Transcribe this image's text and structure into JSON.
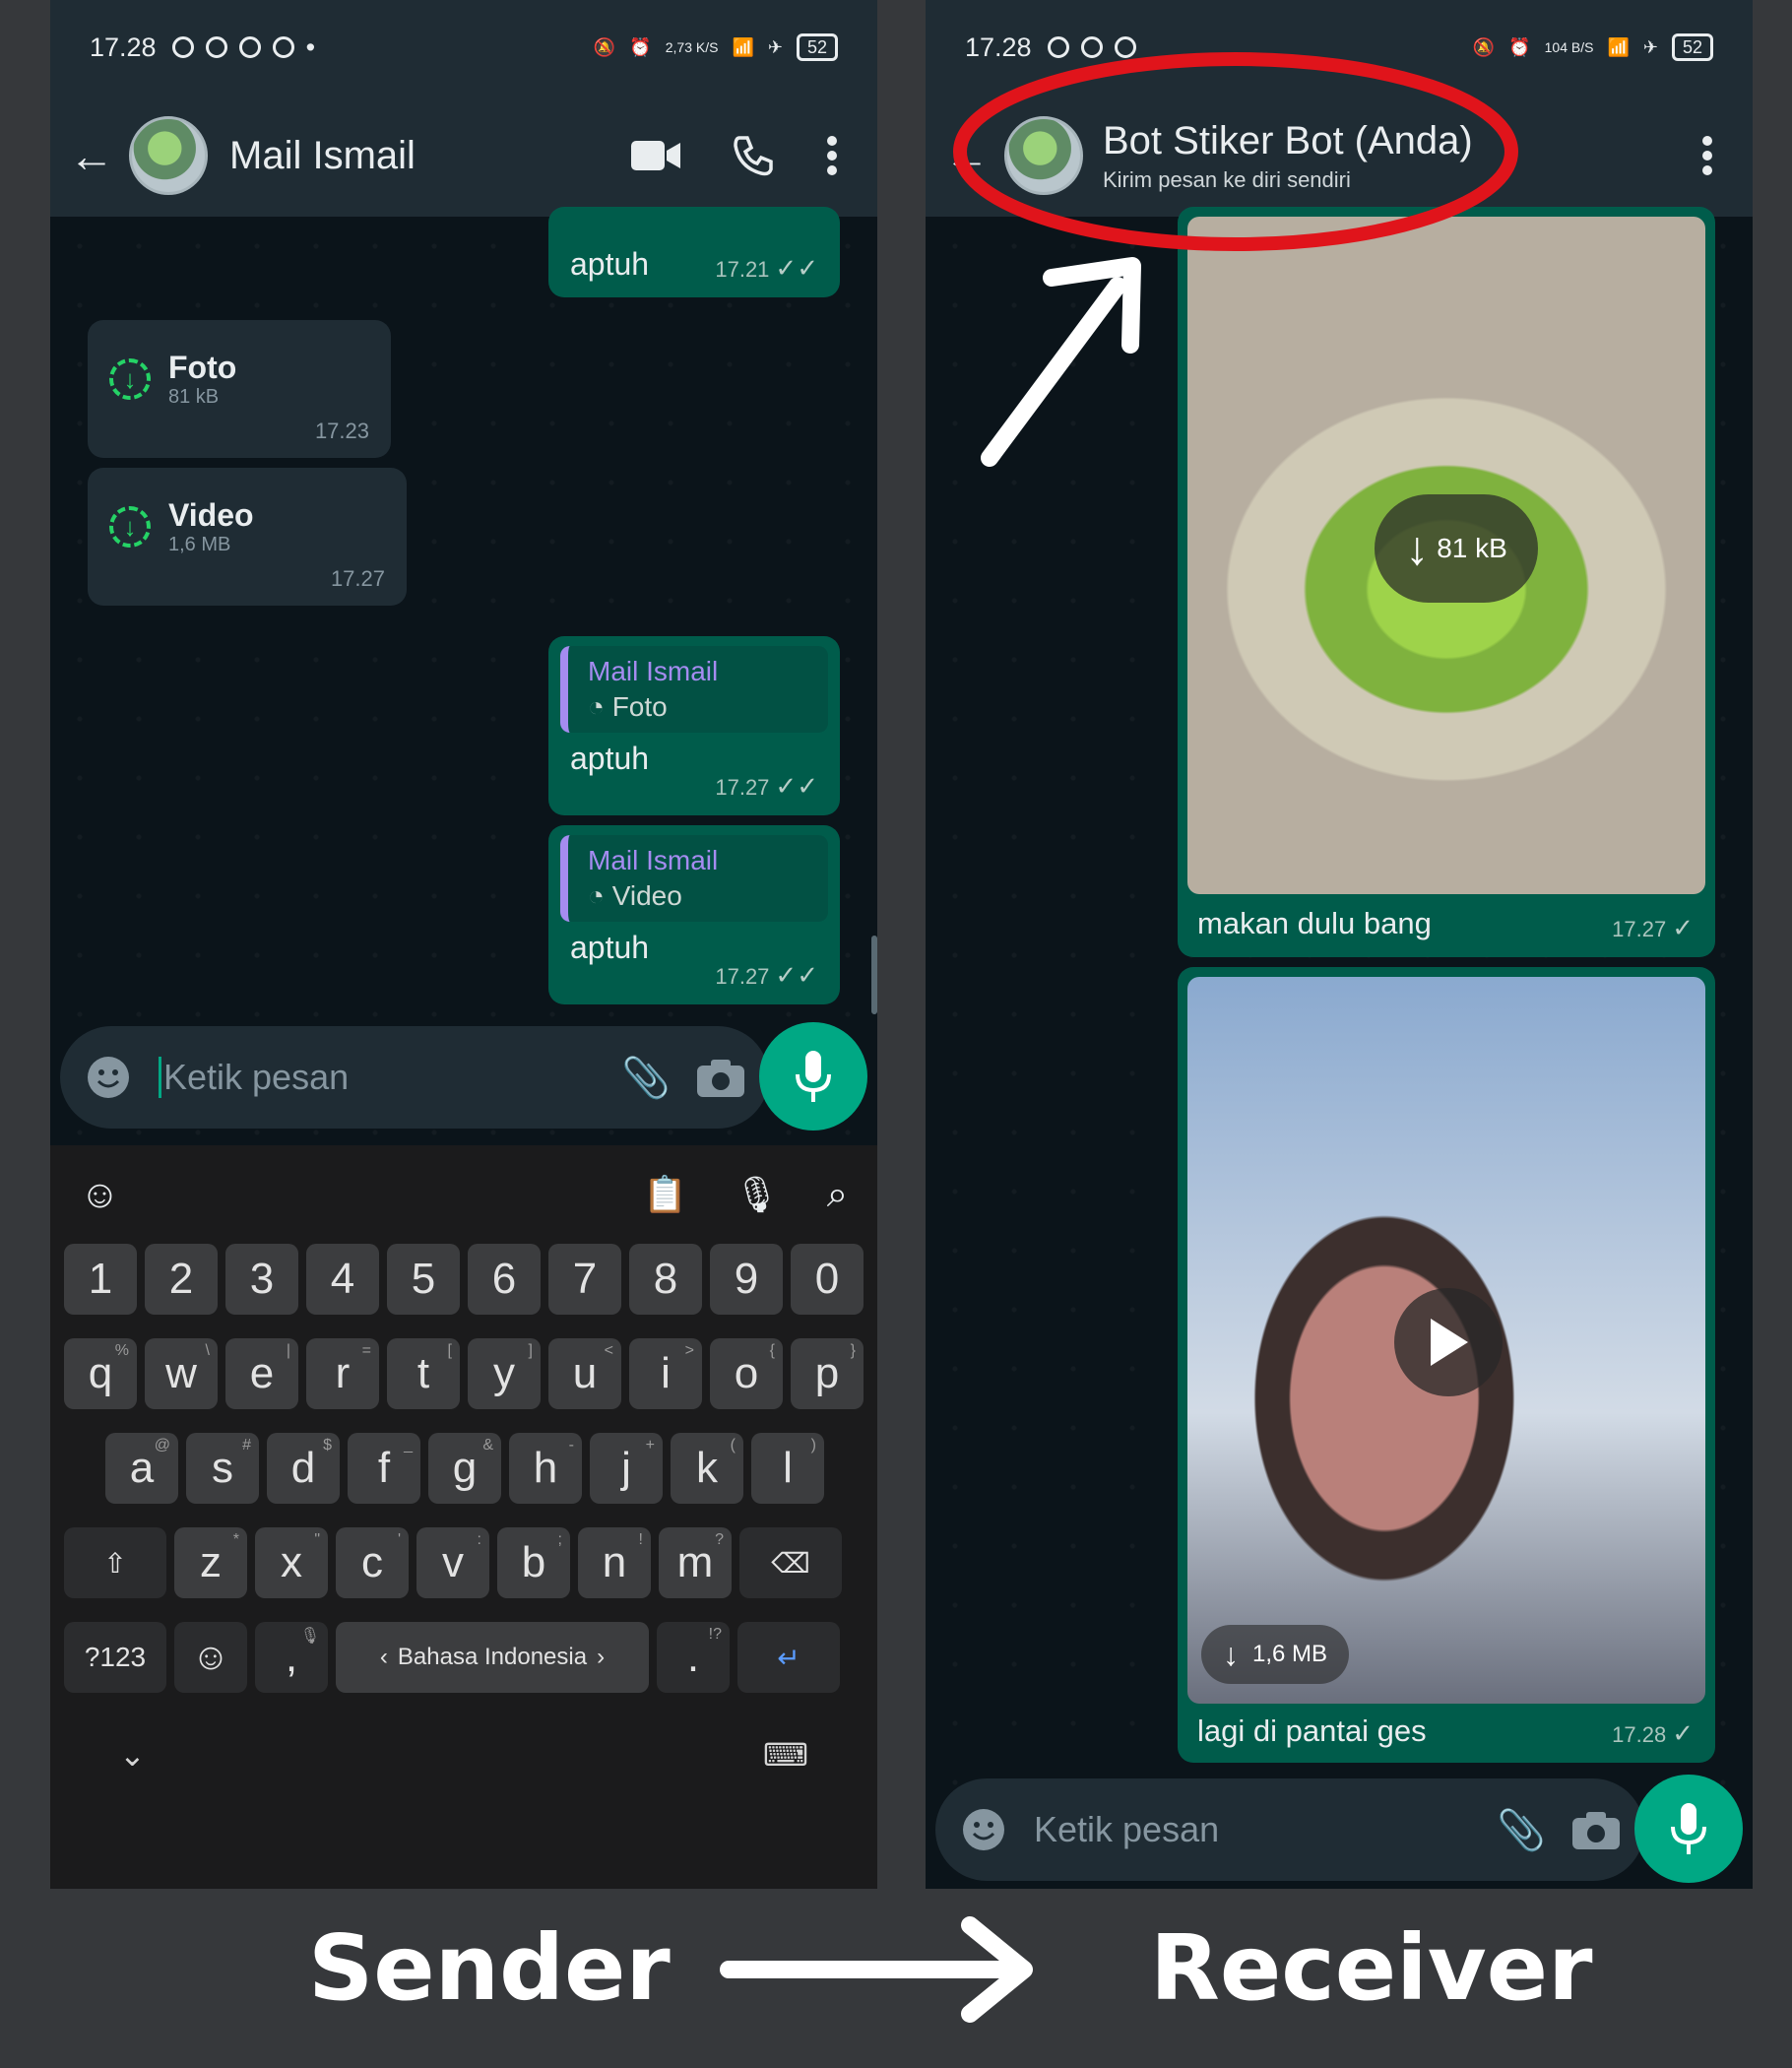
{
  "sender": {
    "status_time": "17.28",
    "net_speed": "2,73 K/S",
    "battery": "52",
    "contact_name": "Mail Ismail",
    "messages": [
      {
        "text": "aptuh",
        "time": "17.21"
      },
      {
        "file": "Foto",
        "size": "81 kB",
        "time": "17.23"
      },
      {
        "file": "Video",
        "size": "1,6 MB",
        "time": "17.27"
      },
      {
        "quote_name": "Mail Ismail",
        "quote_type": "Foto",
        "text": "aptuh",
        "time": "17.27"
      },
      {
        "quote_name": "Mail Ismail",
        "quote_type": "Video",
        "text": "aptuh",
        "time": "17.27"
      }
    ],
    "input_placeholder": "Ketik pesan",
    "keyboard": {
      "numbers": [
        "1",
        "2",
        "3",
        "4",
        "5",
        "6",
        "7",
        "8",
        "9",
        "0"
      ],
      "row1": [
        "q",
        "w",
        "e",
        "r",
        "t",
        "y",
        "u",
        "i",
        "o",
        "p"
      ],
      "row1_sub": [
        "%",
        "\\",
        "|",
        "=",
        "[",
        "]",
        "<",
        ">",
        "{",
        "}"
      ],
      "row2": [
        "a",
        "s",
        "d",
        "f",
        "g",
        "h",
        "j",
        "k",
        "l"
      ],
      "row2_sub": [
        "@",
        "#",
        "$",
        "_",
        "&",
        "-",
        "+",
        "(",
        ")"
      ],
      "row3": [
        "z",
        "x",
        "c",
        "v",
        "b",
        "n",
        "m"
      ],
      "row3_sub": [
        "*",
        "\"",
        "'",
        ":",
        ";",
        "!",
        "?"
      ],
      "sym_label": "?123",
      "comma": ",",
      "period": ".",
      "period_sub": "!?",
      "space_label": "Bahasa Indonesia"
    }
  },
  "receiver": {
    "status_time": "17.28",
    "net_speed": "104 B/S",
    "battery": "52",
    "contact_name": "Bot Stiker Bot (Anda)",
    "contact_subtitle": "Kirim pesan ke diri sendiri",
    "photo": {
      "size": "81 kB",
      "caption": "makan dulu bang",
      "time": "17.27"
    },
    "video": {
      "size": "1,6 MB",
      "caption": "lagi di pantai ges",
      "time": "17.28"
    },
    "input_placeholder": "Ketik pesan"
  },
  "labels": {
    "sender": "Sender",
    "receiver": "Receiver"
  },
  "colors": {
    "accent_green": "#00a884",
    "outgoing_bubble": "#005c4b",
    "highlight_red": "#e0141b"
  }
}
